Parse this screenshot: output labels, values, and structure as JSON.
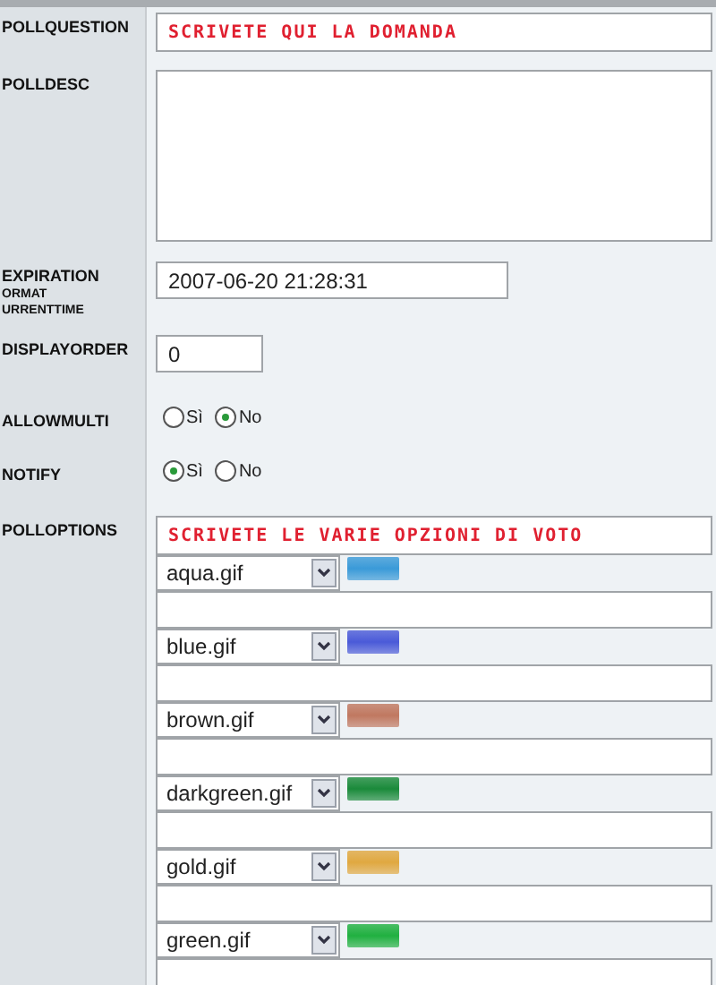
{
  "fields": [
    {
      "kind": "text",
      "label": [
        "POLLQUESTION"
      ],
      "value": "SCRIVETE QUI LA DOMANDA"
    },
    {
      "kind": "textarea",
      "label": [
        "POLLDESC"
      ]
    },
    {
      "kind": "date",
      "label": [
        "EXPIRATION",
        "ORMAT",
        "URRENTTIME"
      ],
      "value": "2007-06-20 21:28:31"
    },
    {
      "kind": "short",
      "label": [
        "DISPLAYORDER"
      ],
      "value": "0"
    },
    {
      "kind": "radio",
      "label": [
        "ALLOWMULTI"
      ],
      "options": [
        {
          "label": "Sì",
          "selected": false
        },
        {
          "label": "No",
          "selected": true
        }
      ]
    },
    {
      "kind": "radio",
      "label": [
        "NOTIFY"
      ],
      "options": [
        {
          "label": "Sì",
          "selected": true
        },
        {
          "label": "No",
          "selected": false
        }
      ]
    },
    {
      "kind": "text",
      "label": [
        "POLLOPTIONS"
      ],
      "value": "SCRIVETE LE VARIE OPZIONI DI VOTO"
    }
  ],
  "options": [
    {
      "image": "aqua.gif",
      "color": "#3a9ad8"
    },
    {
      "image": "blue.gif",
      "color": "#4a5ad8"
    },
    {
      "image": "brown.gif",
      "color": "#c07860"
    },
    {
      "image": "darkgreen.gif",
      "color": "#1a8a3a"
    },
    {
      "image": "gold.gif",
      "color": "#e0a840"
    },
    {
      "image": "green.gif",
      "color": "#20b040"
    }
  ]
}
